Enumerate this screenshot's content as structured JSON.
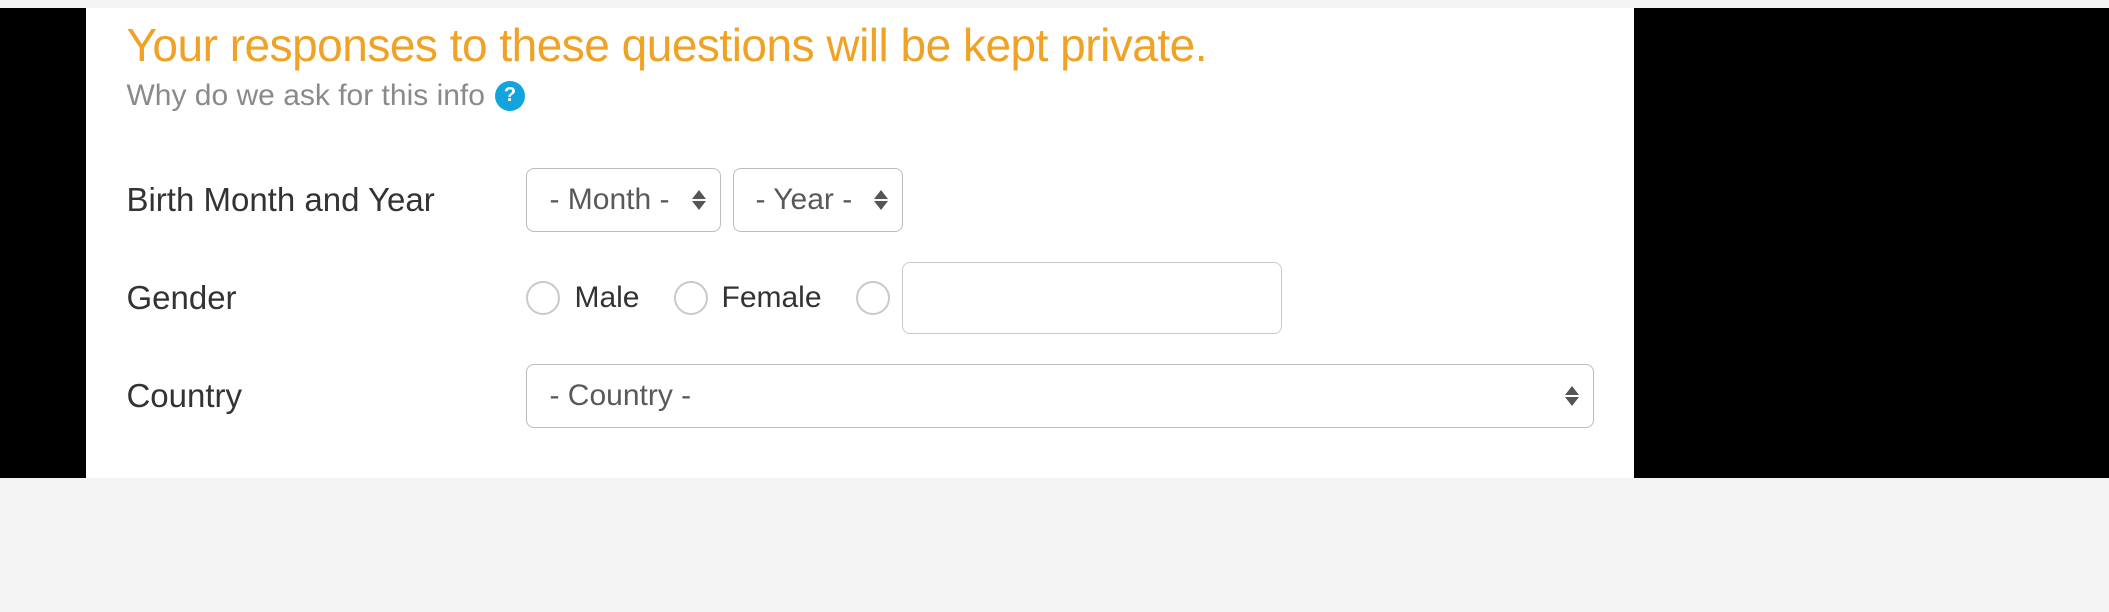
{
  "header": {
    "privacy_notice": "Your responses to these questions will be kept private.",
    "why_label": "Why do we ask for this info",
    "help_glyph": "?"
  },
  "form": {
    "birth": {
      "label": "Birth Month and Year",
      "month_placeholder": "- Month -",
      "year_placeholder": "- Year -"
    },
    "gender": {
      "label": "Gender",
      "option_male": "Male",
      "option_female": "Female",
      "custom_value": ""
    },
    "country": {
      "label": "Country",
      "placeholder": "- Country -"
    }
  }
}
